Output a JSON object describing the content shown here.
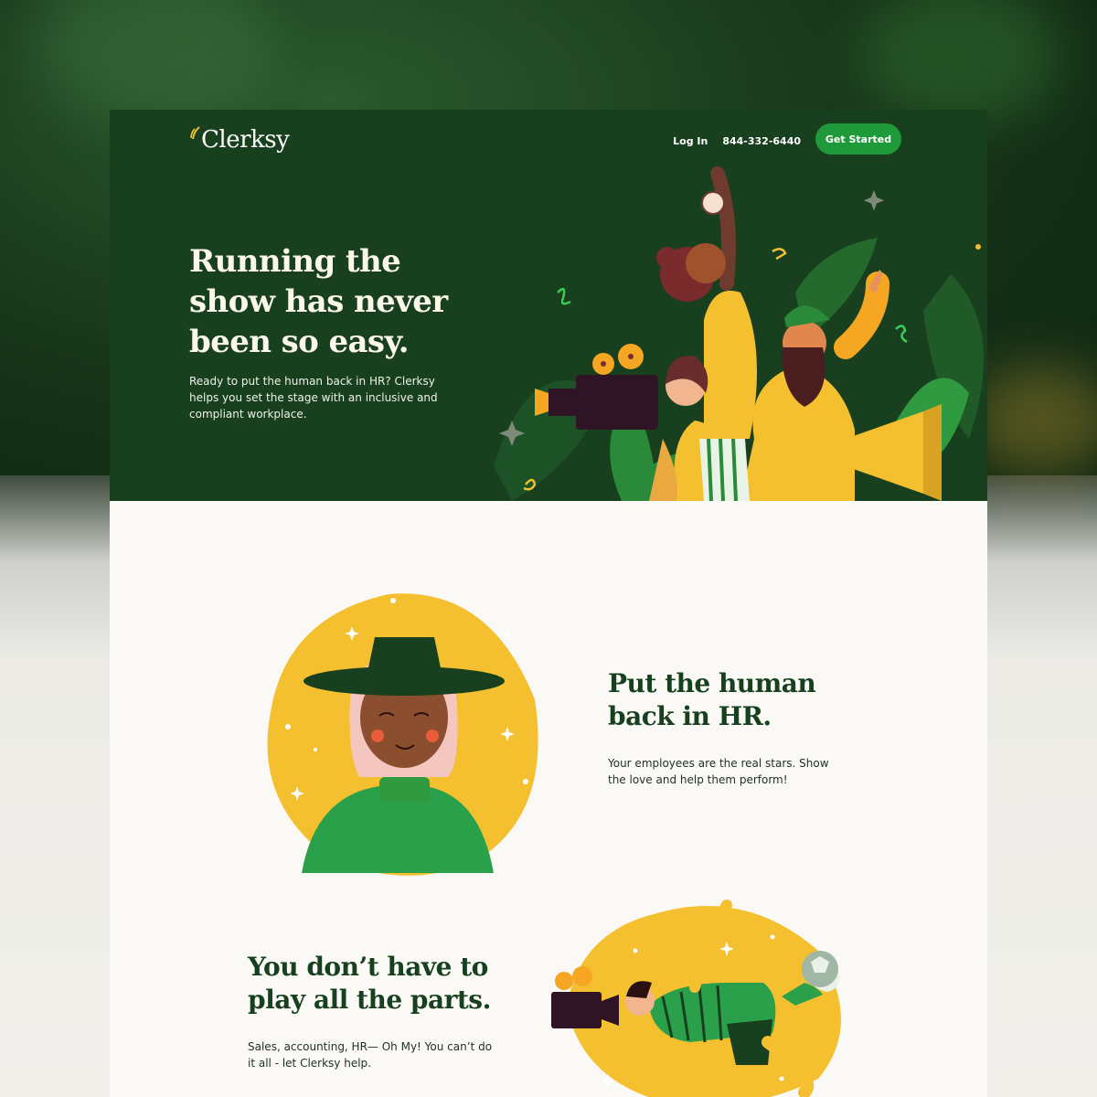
{
  "brand": {
    "name": "Clerksy",
    "colors": {
      "dark_green": "#18401f",
      "button_green": "#1f9a3a",
      "yellow": "#f5c030",
      "cream": "#faf9f6"
    }
  },
  "nav": {
    "login": "Log In",
    "phone": "844-332-6440",
    "cta": "Get Started"
  },
  "hero": {
    "title": "Running the show has never been so easy.",
    "subtitle": "Ready to put the human back in HR? Clerksy helps you set the stage with an inclusive and compliant workplace."
  },
  "section1": {
    "title": "Put the human back in HR.",
    "text": "Your employees are the real stars. Show the love and help them perform!"
  },
  "section2": {
    "title": "You don’t have to play all the parts.",
    "text": "Sales, accounting, HR— Oh My! You can’t do it all - let Clerksy help."
  }
}
